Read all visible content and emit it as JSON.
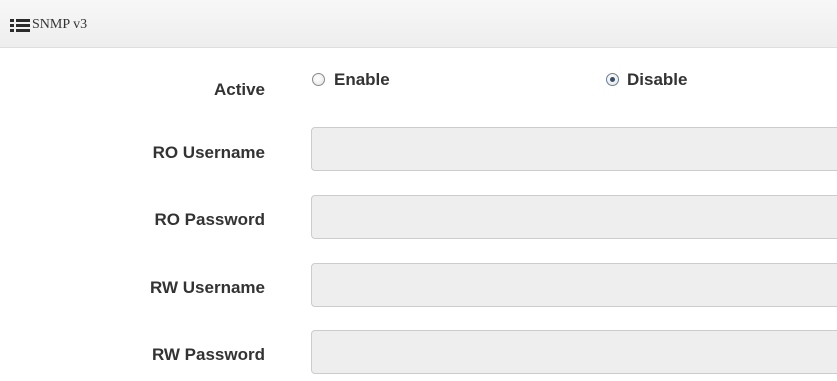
{
  "panel": {
    "title": "SNMP v3",
    "icon": "list-icon"
  },
  "form": {
    "active": {
      "label": "Active",
      "options": [
        {
          "label": "Enable",
          "checked": false
        },
        {
          "label": "Disable",
          "checked": true
        }
      ]
    },
    "ro_username": {
      "label": "RO Username",
      "value": ""
    },
    "ro_password": {
      "label": "RO Password",
      "value": ""
    },
    "rw_username": {
      "label": "RW Username",
      "value": ""
    },
    "rw_password": {
      "label": "RW Password",
      "value": ""
    }
  },
  "colors": {
    "header_bg": "#eeeeee",
    "input_bg": "#eeeeee",
    "label_text": "#333333"
  }
}
